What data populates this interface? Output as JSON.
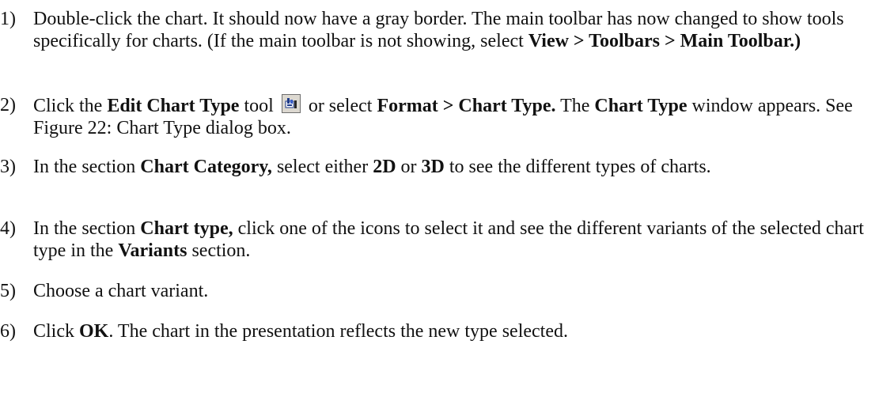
{
  "steps": [
    {
      "num": "1)",
      "parts": {
        "t1": "Double-click the chart. It should now have a gray border. The main toolbar has now changed to show tools specifically for charts. (If the main toolbar is not showing, select ",
        "b1": "View > Toolbars > Main Toolbar.)"
      }
    },
    {
      "num": "2)",
      "parts": {
        "t1": "Click the ",
        "b1": "Edit Chart Type",
        "t2": " tool ",
        "icon": "edit-chart-type-icon",
        "t3": " or select ",
        "b2": "Format > Chart Type.",
        "t4": " The ",
        "b3": "Chart Type",
        "t5": " window appears. See Figure 22: Chart Type dialog box."
      }
    },
    {
      "num": "3)",
      "parts": {
        "t1": "In the section ",
        "b1": "Chart Category,",
        "t2": " select either ",
        "b2": "2D",
        "t3": " or ",
        "b3": "3D",
        "t4": " to see the different types of charts."
      }
    },
    {
      "num": "4)",
      "parts": {
        "t1": "In the section ",
        "b1": "Chart type,",
        "t2": " click one of the icons to select it and see the different variants of the selected chart type in the ",
        "b2": "Variants",
        "t3": " section."
      }
    },
    {
      "num": "5)",
      "parts": {
        "t1": "Choose a chart variant."
      }
    },
    {
      "num": "6)",
      "parts": {
        "t1": "Click ",
        "b1": "OK",
        "t2": ". The chart in the presentation reflects the new type selected."
      }
    }
  ]
}
